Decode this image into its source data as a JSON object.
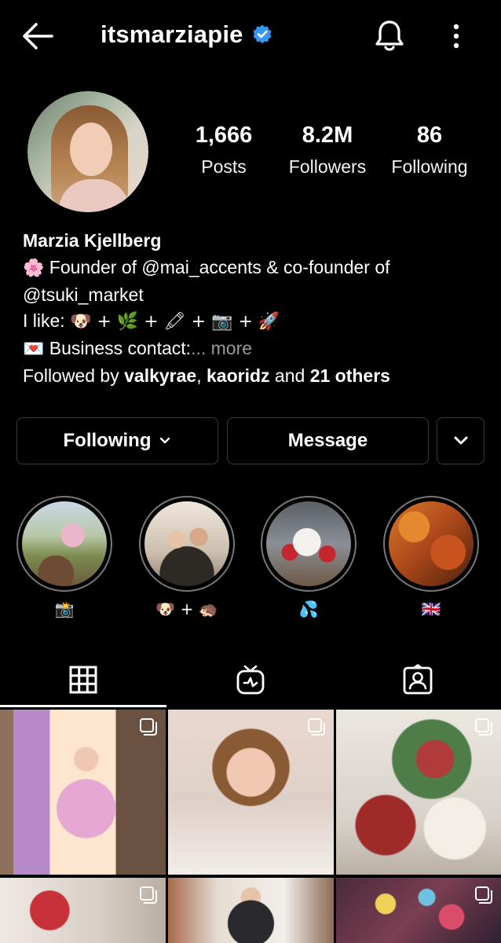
{
  "header": {
    "username": "itsmarziapie",
    "verified": true,
    "icons": [
      "back-arrow-icon",
      "verified-badge-icon",
      "bell-icon",
      "more-vertical-icon"
    ]
  },
  "stats": [
    {
      "value": "1,666",
      "label": "Posts"
    },
    {
      "value": "8.2M",
      "label": "Followers"
    },
    {
      "value": "86",
      "label": "Following"
    }
  ],
  "bio": {
    "name": "Marzia Kjellberg",
    "line1_emoji": "🌸",
    "line1_text": " Founder of @mai_accents & co-founder of",
    "line2_text": "@tsuki_market",
    "line3_text": "I like: ",
    "line3_emoji": "🐶 + 🌿 + 🖍 + 📷 + 🚀",
    "line4_emoji": "💌",
    "line4_text": " Business contact:",
    "line4_more": "... more",
    "followed_prefix": "Followed by ",
    "followed_user1": "valkyrae",
    "followed_sep": ", ",
    "followed_user2": "kaoridz",
    "followed_and": " and ",
    "followed_others": "21 others"
  },
  "actions": {
    "following_label": "Following",
    "message_label": "Message"
  },
  "highlights": [
    {
      "caption": "📸"
    },
    {
      "caption": "🐶 + 🦔"
    },
    {
      "caption": "💦"
    },
    {
      "caption": "🇬🇧"
    }
  ],
  "tabs": [
    "grid-icon",
    "igtv-icon",
    "tagged-icon"
  ],
  "colors": {
    "background": "#000000",
    "text": "#ffffff",
    "muted": "#9a9a9a",
    "border": "#3b3b3b",
    "verified": "#3897f0"
  }
}
